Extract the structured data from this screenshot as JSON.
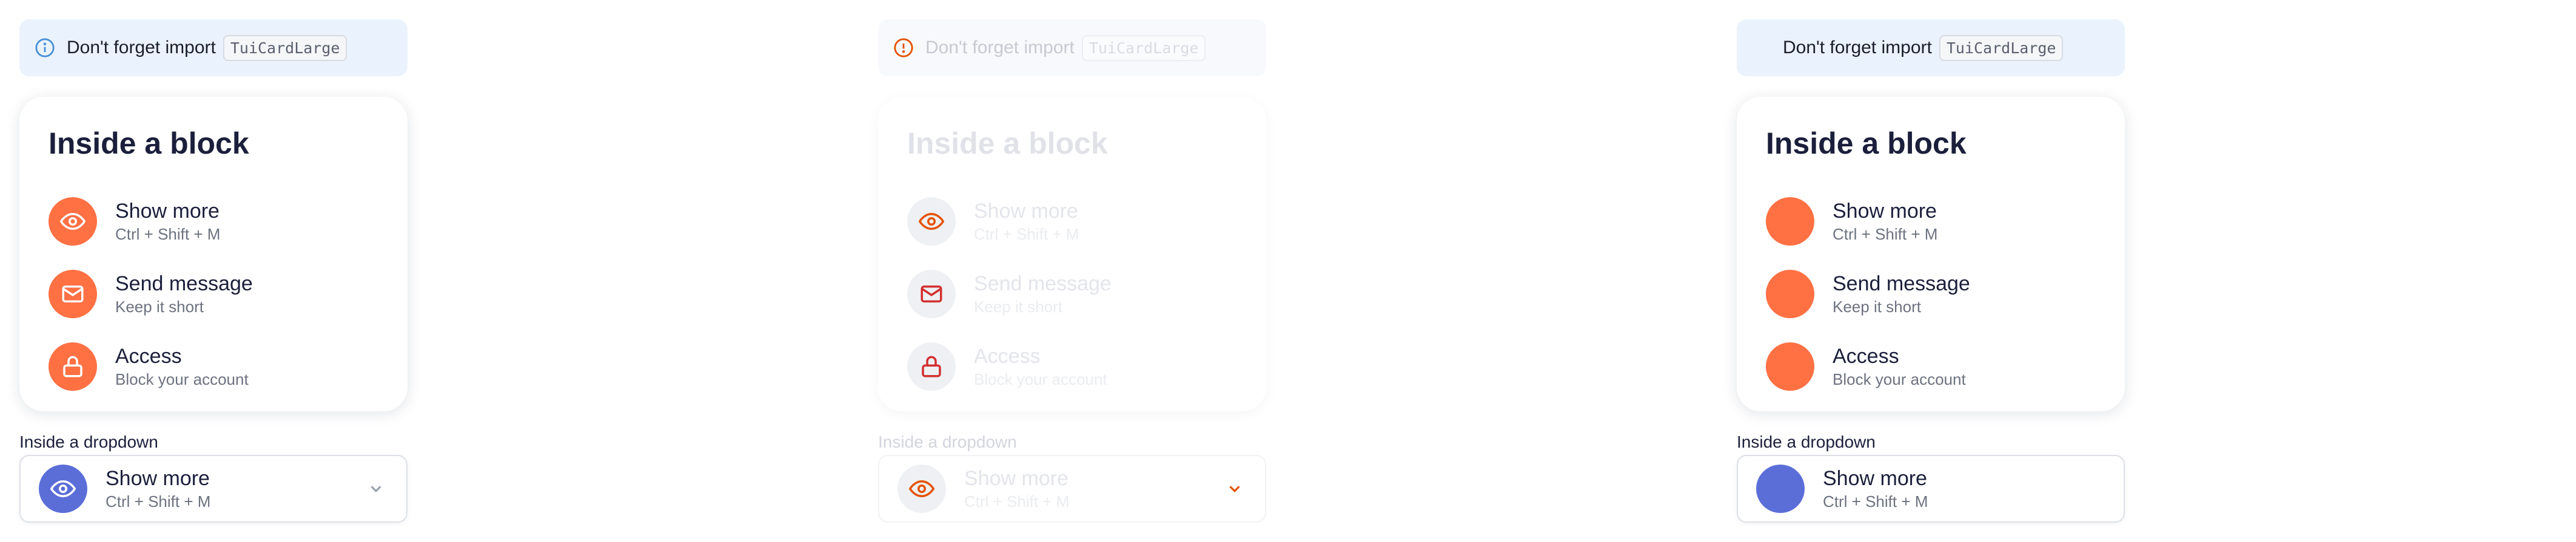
{
  "notice": {
    "text": "Don't forget import",
    "code": "TuiCardLarge"
  },
  "card": {
    "title": "Inside a block",
    "items": [
      {
        "label": "Show more",
        "sub": "Ctrl + Shift + M",
        "icon": "eye-icon"
      },
      {
        "label": "Send message",
        "sub": "Keep it short",
        "icon": "mail-icon"
      },
      {
        "label": "Access",
        "sub": "Block your account",
        "icon": "lock-icon"
      }
    ]
  },
  "dropdown": {
    "label": "Inside a dropdown",
    "selected_label": "Show more",
    "selected_sub": "Ctrl + Shift + M",
    "icon": "eye-icon",
    "chevron": "chevron-down-icon"
  },
  "colors": {
    "accent": "#ff7043",
    "accent_dark": "#d84315",
    "dropdown_icon": "#5b6ed8",
    "info_blue": "#4a90d9",
    "notice_bg": "#eaf3fd"
  }
}
